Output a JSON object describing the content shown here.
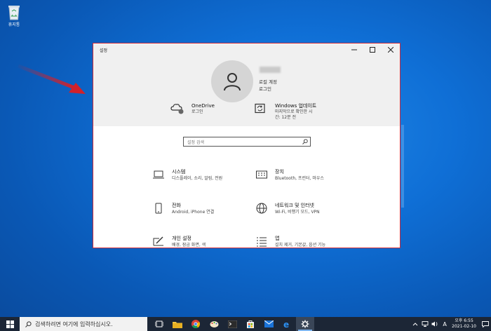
{
  "desktop": {
    "recycle_bin_label": "휴지통"
  },
  "window": {
    "title": "설정",
    "controls": [
      "minimize",
      "maximize",
      "close"
    ],
    "accent_color": "#cc2a3a"
  },
  "account": {
    "type": "로컬 계정",
    "action": "로그인"
  },
  "quick_items": [
    {
      "title": "OneDrive",
      "subtitle": "로그인",
      "icon": "cloud-icon"
    },
    {
      "title": "Windows 업데이트",
      "subtitle1": "마지막으로 확인한 시",
      "subtitle2": "간: 12분 전",
      "icon": "update-icon"
    }
  ],
  "search": {
    "placeholder": "설정 검색"
  },
  "categories": [
    {
      "title": "시스템",
      "subtitle": "디스플레이, 소리, 알림, 전원",
      "icon": "laptop-icon"
    },
    {
      "title": "장치",
      "subtitle": "Bluetooth, 프린터, 마우스",
      "icon": "keyboard-icon"
    },
    {
      "title": "전화",
      "subtitle": "Android, iPhone 연결",
      "icon": "phone-icon"
    },
    {
      "title": "네트워크 및 인터넷",
      "subtitle": "Wi-Fi, 비행기 모드, VPN",
      "icon": "globe-icon"
    },
    {
      "title": "개인 설정",
      "subtitle": "배경, 잠금 화면, 색",
      "icon": "personalize-icon"
    },
    {
      "title": "앱",
      "subtitle": "설치 제거, 기본값, 옵션 기능",
      "icon": "apps-icon"
    }
  ],
  "taskbar": {
    "search_text": "검색하려면 여기에 입력하십시오.",
    "language": "A",
    "time": "오후 6:55",
    "date": "2021-02-10"
  }
}
